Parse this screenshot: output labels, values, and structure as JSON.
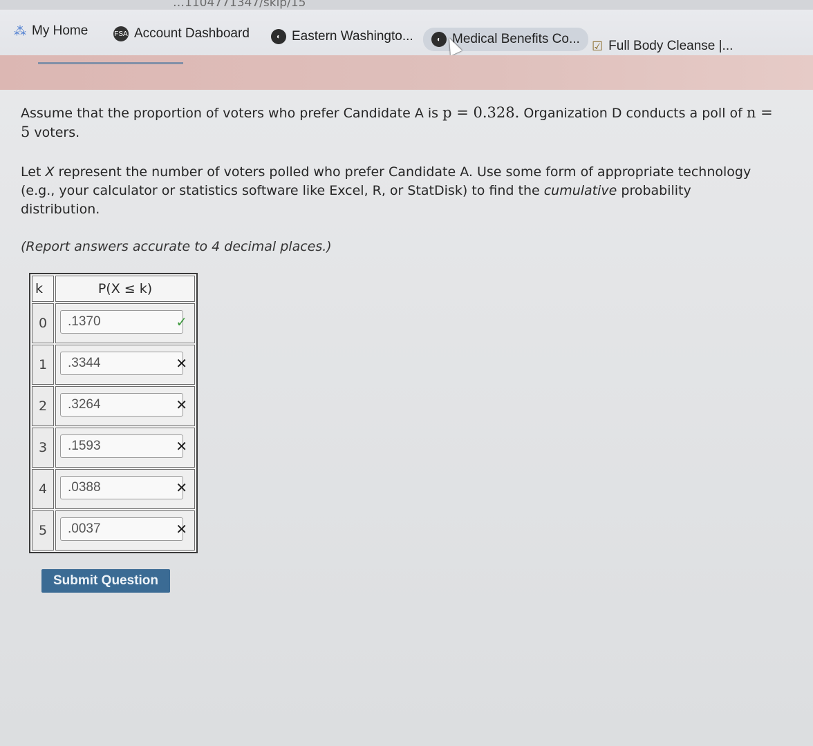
{
  "browser": {
    "url_fragment": "…1104771347/skip/15",
    "bookmarks": [
      {
        "label": "My Home",
        "icon": "apps-icon"
      },
      {
        "label": "Account Dashboard",
        "icon": "fsa-icon",
        "icon_text": "FSA"
      },
      {
        "label": "Eastern Washingto...",
        "icon": "globe-icon"
      },
      {
        "label": "Medical Benefits Co...",
        "icon": "globe-icon"
      },
      {
        "label": "Full Body Cleanse |...",
        "icon": "checkbox-icon"
      }
    ]
  },
  "question": {
    "intro_a": "Assume that the proportion of voters who prefer Candidate A is ",
    "p_symbol": "p = 0.328.",
    "intro_b": " Organization D conducts a poll of ",
    "n_symbol": "n = 5",
    "intro_c": " voters.",
    "let_a": "Let ",
    "let_x": "X",
    "let_b": " represent the number of voters polled who prefer Candidate A.  Use some form of appropriate technology (e.g., your calculator or statistics software like Excel, R, or StatDisk) to find the ",
    "let_cum": "cumulative",
    "let_c": " probability distribution.",
    "note": "(Report answers accurate to 4 decimal places.)"
  },
  "table": {
    "col_k": "k",
    "col_p": "P(X ≤ k)",
    "rows": [
      {
        "k": "0",
        "answer": ".1370",
        "status": "✓"
      },
      {
        "k": "1",
        "answer": ".3344",
        "status": "✕"
      },
      {
        "k": "2",
        "answer": ".3264",
        "status": "✕"
      },
      {
        "k": "3",
        "answer": ".1593",
        "status": "✕"
      },
      {
        "k": "4",
        "answer": ".0388",
        "status": "✕"
      },
      {
        "k": "5",
        "answer": ".0037",
        "status": "✕"
      }
    ]
  },
  "submit_label": "Submit Question",
  "colors": {
    "correct": "#3f9a3f",
    "incorrect": "#1c1c1c",
    "submit_bg": "#3b6b94"
  }
}
